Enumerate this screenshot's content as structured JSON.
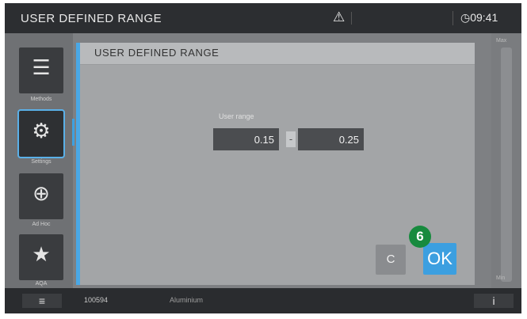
{
  "topbar": {
    "title": "USER DEFINED RANGE",
    "warning_icon": "⚠",
    "time": "09:41",
    "clock_icon": "clock-icon"
  },
  "sidebar": {
    "items": [
      {
        "label": "Methods",
        "icon": "methods-list-icon",
        "glyph": "☰"
      },
      {
        "label": "Settings",
        "icon": "settings-gear-icon",
        "glyph": "⚙"
      },
      {
        "label": "Ad Hoc",
        "icon": "adhoc-icon",
        "glyph": "⊕"
      },
      {
        "label": "AQA",
        "icon": "aqa-stars-icon",
        "glyph": "★"
      }
    ]
  },
  "rightbar": {
    "top_label": "Max",
    "bottom_label": "Min"
  },
  "dialog": {
    "title": "USER DEFINED RANGE",
    "range_label": "User range",
    "range_min": "0.15",
    "range_separator": "-",
    "range_max": "0.25",
    "cancel_label": "C",
    "ok_label": "OK"
  },
  "badge": "6",
  "bottombar": {
    "menu_icon": "≡",
    "code": "100594",
    "name": "Aluminium",
    "info_icon": "i"
  }
}
